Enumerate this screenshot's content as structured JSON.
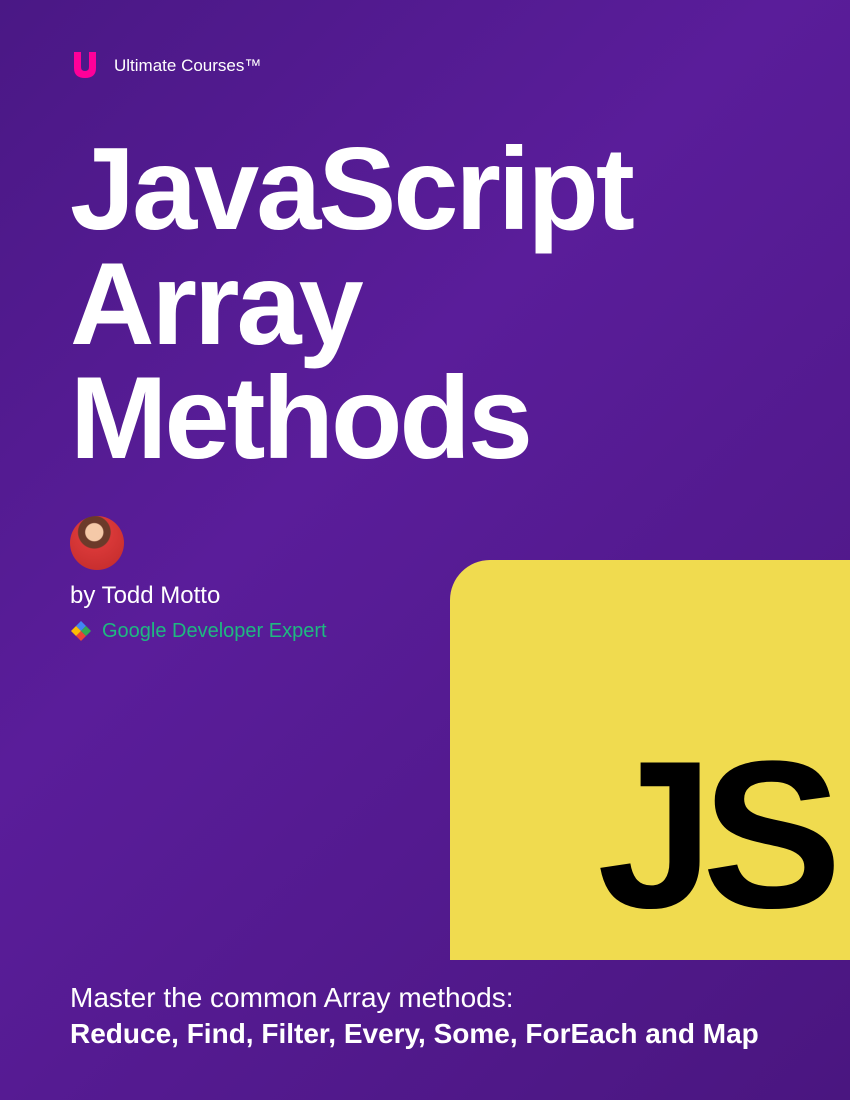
{
  "header": {
    "brand": "Ultimate Courses™"
  },
  "title": {
    "line1": "JavaScript",
    "line2": "Array",
    "line3": "Methods"
  },
  "author": {
    "byline": "by Todd Motto",
    "badge": "Google Developer Expert"
  },
  "jsLogo": {
    "text": "JS"
  },
  "footer": {
    "intro": "Master the common Array methods:",
    "methods": "Reduce, Find, Filter, Every, Some, ForEach and Map"
  }
}
